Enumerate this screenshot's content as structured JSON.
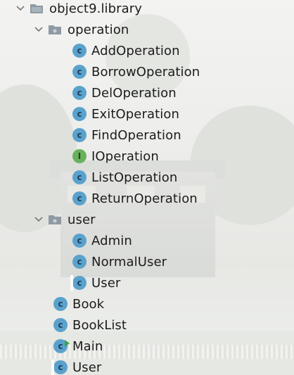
{
  "tree": {
    "root": {
      "label": "object9.library",
      "expanded": true,
      "icon": "folder-icon"
    },
    "packages": [
      {
        "label": "operation",
        "expanded": true,
        "icon": "folder-icon",
        "items": [
          {
            "label": "AddOperation",
            "icon": "class-icon",
            "kind": "C"
          },
          {
            "label": "BorrowOperation",
            "icon": "class-icon",
            "kind": "C"
          },
          {
            "label": "DelOperation",
            "icon": "class-icon",
            "kind": "C"
          },
          {
            "label": "ExitOperation",
            "icon": "class-icon",
            "kind": "C"
          },
          {
            "label": "FindOperation",
            "icon": "class-icon",
            "kind": "C"
          },
          {
            "label": "IOperation",
            "icon": "interface-icon",
            "kind": "I"
          },
          {
            "label": "ListOperation",
            "icon": "class-icon",
            "kind": "C"
          },
          {
            "label": "ReturnOperation",
            "icon": "class-icon",
            "kind": "C"
          }
        ]
      },
      {
        "label": "user",
        "expanded": true,
        "icon": "folder-icon",
        "items": [
          {
            "label": "Admin",
            "icon": "class-icon",
            "kind": "C"
          },
          {
            "label": "NormalUser",
            "icon": "class-icon",
            "kind": "C"
          },
          {
            "label": "User",
            "icon": "class-file-icon",
            "kind": "C"
          }
        ]
      }
    ],
    "files": [
      {
        "label": "Book",
        "icon": "class-icon",
        "kind": "C"
      },
      {
        "label": "BookList",
        "icon": "class-icon",
        "kind": "C"
      },
      {
        "label": "Main",
        "icon": "main-class-icon",
        "kind": "C"
      },
      {
        "label": "User",
        "icon": "class-file-icon",
        "kind": "C"
      }
    ]
  },
  "colors": {
    "class_icon": "#5aa2cc",
    "interface_icon": "#67b15c",
    "folder_icon": "#8f9aa5",
    "text": "#1c1c1c"
  }
}
